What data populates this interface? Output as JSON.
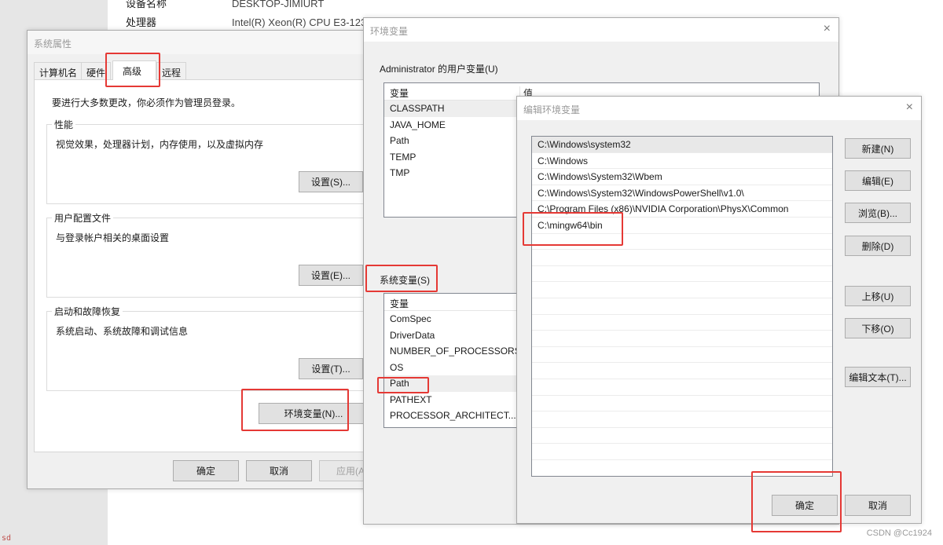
{
  "background": {
    "device_name_label": "设备名称",
    "device_name_value": "DESKTOP-JIMIURT",
    "processor_label": "处理器",
    "processor_value": "Intel(R) Xeon(R) CPU E3-123",
    "corner_label": "sd"
  },
  "system_properties": {
    "title": "系统属性",
    "tabs": [
      {
        "label": "计算机名",
        "active": false
      },
      {
        "label": "硬件",
        "active": false
      },
      {
        "label": "高级",
        "active": true
      },
      {
        "label": "远程",
        "active": false
      }
    ],
    "admin_note": "要进行大多数更改，你必须作为管理员登录。",
    "groups": [
      {
        "legend": "性能",
        "description": "视觉效果，处理器计划，内存使用，以及虚拟内存",
        "button": "设置(S)..."
      },
      {
        "legend": "用户配置文件",
        "description": "与登录帐户相关的桌面设置",
        "button": "设置(E)..."
      },
      {
        "legend": "启动和故障恢复",
        "description": "系统启动、系统故障和调试信息",
        "button": "设置(T)..."
      }
    ],
    "env_button": "环境变量(N)...",
    "ok_button": "确定",
    "cancel_button": "取消",
    "apply_button": "应用(A)"
  },
  "environment_variables": {
    "title": "环境变量",
    "close_icon": "×",
    "user_section_label": "Administrator 的用户变量(U)",
    "user_columns": [
      "变量",
      "值"
    ],
    "user_vars": [
      "CLASSPATH",
      "JAVA_HOME",
      "Path",
      "TEMP",
      "TMP"
    ],
    "system_section_label": "系统变量(S)",
    "system_columns": [
      "变量"
    ],
    "system_vars": [
      "ComSpec",
      "DriverData",
      "NUMBER_OF_PROCESSORS",
      "OS",
      "Path",
      "PATHEXT",
      "PROCESSOR_ARCHITECT..."
    ],
    "selected_system_var": "Path"
  },
  "edit_variable": {
    "title": "编辑环境变量",
    "close_icon": "×",
    "paths": [
      "C:\\Windows\\system32",
      "C:\\Windows",
      "C:\\Windows\\System32\\Wbem",
      "C:\\Windows\\System32\\WindowsPowerShell\\v1.0\\",
      "C:\\Program Files (x86)\\NVIDIA Corporation\\PhysX\\Common",
      "C:\\mingw64\\bin"
    ],
    "buttons": {
      "new": "新建(N)",
      "edit": "编辑(E)",
      "browse": "浏览(B)...",
      "delete": "删除(D)",
      "move_up": "上移(U)",
      "move_down": "下移(O)",
      "edit_text": "编辑文本(T)..."
    },
    "ok_button": "确定",
    "cancel_button": "取消"
  },
  "watermark": "CSDN @Cc1924",
  "colors": {
    "highlight_red": "#e53935",
    "dialog_bg": "#f0f0f0",
    "button_bg": "#e1e1e1"
  }
}
